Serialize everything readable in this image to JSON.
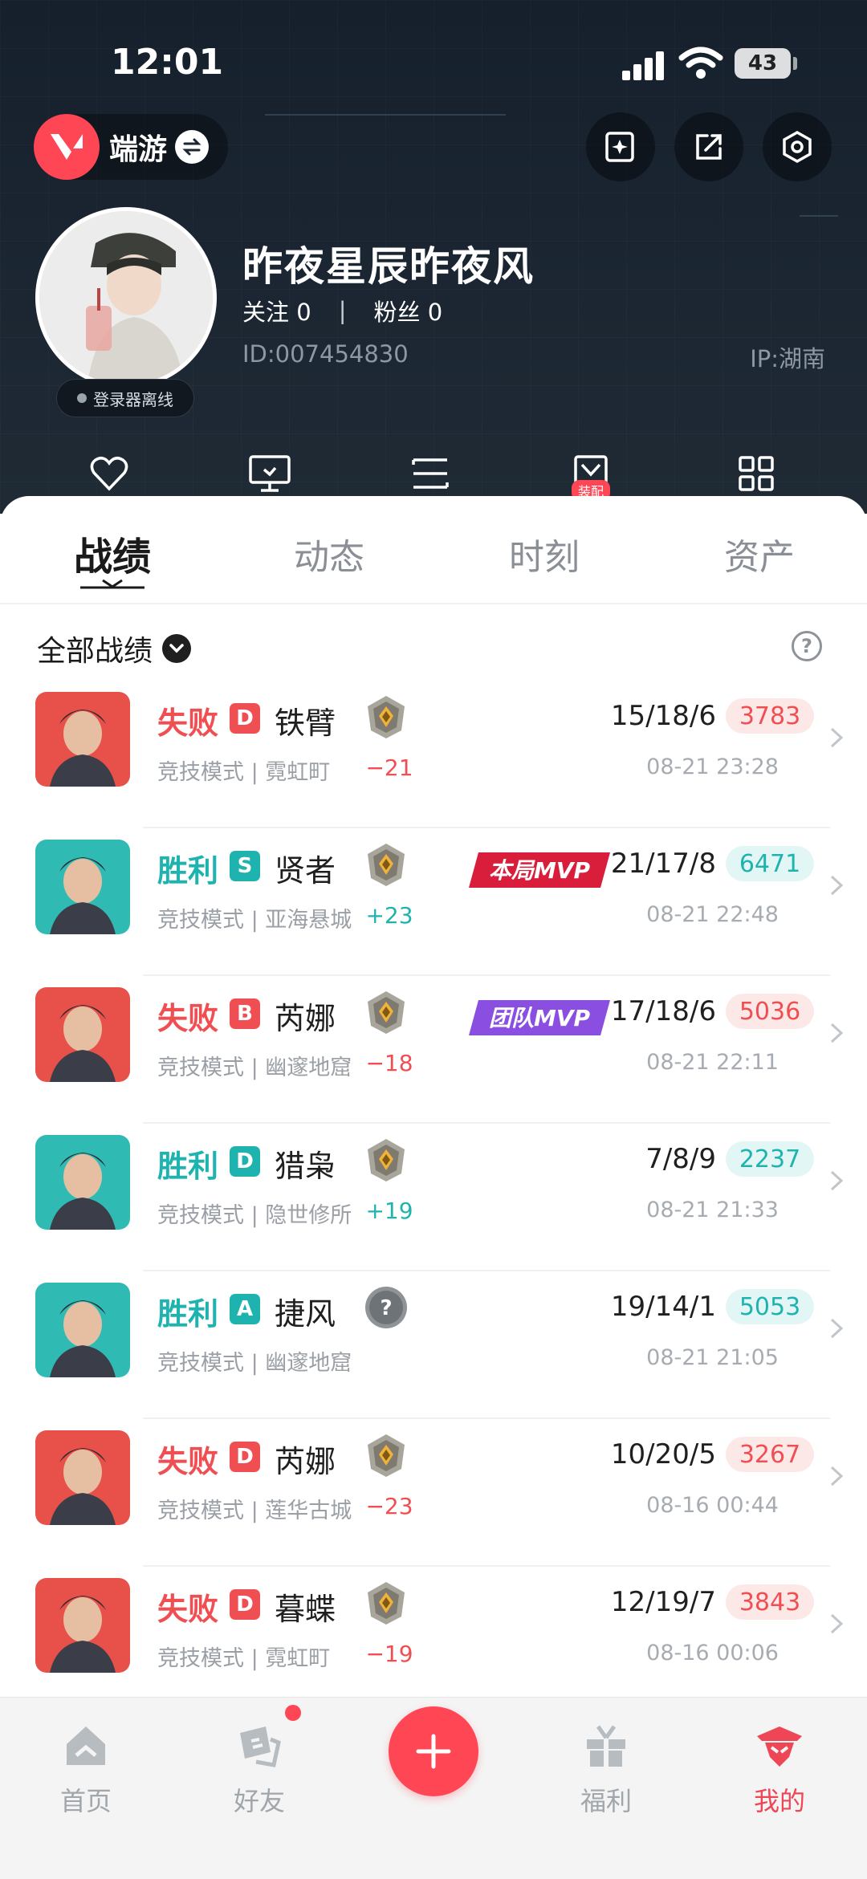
{
  "status_bar": {
    "time": "12:01",
    "battery": "43"
  },
  "brand": {
    "label": "端游"
  },
  "profile": {
    "nickname": "昨夜星辰昨夜风",
    "following_label": "关注",
    "following_count": "0",
    "followers_label": "粉丝",
    "followers_count": "0",
    "id": "ID:007454830",
    "ip": "IP:湖南",
    "online_status": "登录器离线"
  },
  "tool_badge": "装配",
  "tabs": [
    "战绩",
    "动态",
    "时刻",
    "资产"
  ],
  "filter": {
    "label": "全部战绩"
  },
  "matches": [
    {
      "result": "失败",
      "outcome": "lose",
      "grade": "D",
      "agent": "铁臂",
      "mode": "竞技模式 | 霓虹町",
      "rank_icon": "rank-icon",
      "delta": "−21",
      "mvp": "",
      "kda": "15/18/6",
      "score": "3783",
      "time": "08-21 23:28",
      "portrait_color": "#e8504a"
    },
    {
      "result": "胜利",
      "outcome": "win",
      "grade": "S",
      "agent": "贤者",
      "mode": "竞技模式 | 亚海悬城",
      "rank_icon": "rank-icon",
      "delta": "+23",
      "mvp": "本局MVP",
      "mvp_color": "#d81e3a",
      "kda": "21/17/8",
      "score": "6471",
      "time": "08-21 22:48",
      "portrait_color": "#2fbbb4"
    },
    {
      "result": "失败",
      "outcome": "lose",
      "grade": "B",
      "agent": "芮娜",
      "mode": "竞技模式 | 幽邃地窟",
      "rank_icon": "rank-icon",
      "delta": "−18",
      "mvp": "团队MVP",
      "mvp_color": "#8a4fe0",
      "kda": "17/18/6",
      "score": "5036",
      "time": "08-21 22:11",
      "portrait_color": "#e8504a"
    },
    {
      "result": "胜利",
      "outcome": "win",
      "grade": "D",
      "agent": "猎枭",
      "mode": "竞技模式 | 隐世修所",
      "rank_icon": "rank-icon",
      "delta": "+19",
      "mvp": "",
      "kda": "7/8/9",
      "score": "2237",
      "time": "08-21 21:33",
      "portrait_color": "#2fbbb4"
    },
    {
      "result": "胜利",
      "outcome": "win",
      "grade": "A",
      "agent": "捷风",
      "mode": "竞技模式 | 幽邃地窟",
      "rank_icon": "unknown-rank-icon",
      "delta": "",
      "mvp": "",
      "kda": "19/14/1",
      "score": "5053",
      "time": "08-21 21:05",
      "portrait_color": "#2fbbb4"
    },
    {
      "result": "失败",
      "outcome": "lose",
      "grade": "D",
      "agent": "芮娜",
      "mode": "竞技模式 | 莲华古城",
      "rank_icon": "rank-icon",
      "delta": "−23",
      "mvp": "",
      "kda": "10/20/5",
      "score": "3267",
      "time": "08-16 00:44",
      "portrait_color": "#e8504a"
    },
    {
      "result": "失败",
      "outcome": "lose",
      "grade": "D",
      "agent": "暮蝶",
      "mode": "竞技模式 | 霓虹町",
      "rank_icon": "rank-icon",
      "delta": "−19",
      "mvp": "",
      "kda": "12/19/7",
      "score": "3843",
      "time": "08-16 00:06",
      "portrait_color": "#e8504a"
    }
  ],
  "bottom_nav": [
    {
      "label": "首页",
      "icon": "home-icon",
      "active": false
    },
    {
      "label": "好友",
      "icon": "friends-icon",
      "active": false,
      "badge": true
    },
    {
      "label": "",
      "icon": "plus-icon",
      "active": false
    },
    {
      "label": "福利",
      "icon": "gift-icon",
      "active": false
    },
    {
      "label": "我的",
      "icon": "profile-icon",
      "active": true
    }
  ],
  "colors": {
    "accent": "#ff4655",
    "win": "#1fb3b0",
    "lose": "#ef4f52",
    "header_bg": "#1b2632"
  }
}
